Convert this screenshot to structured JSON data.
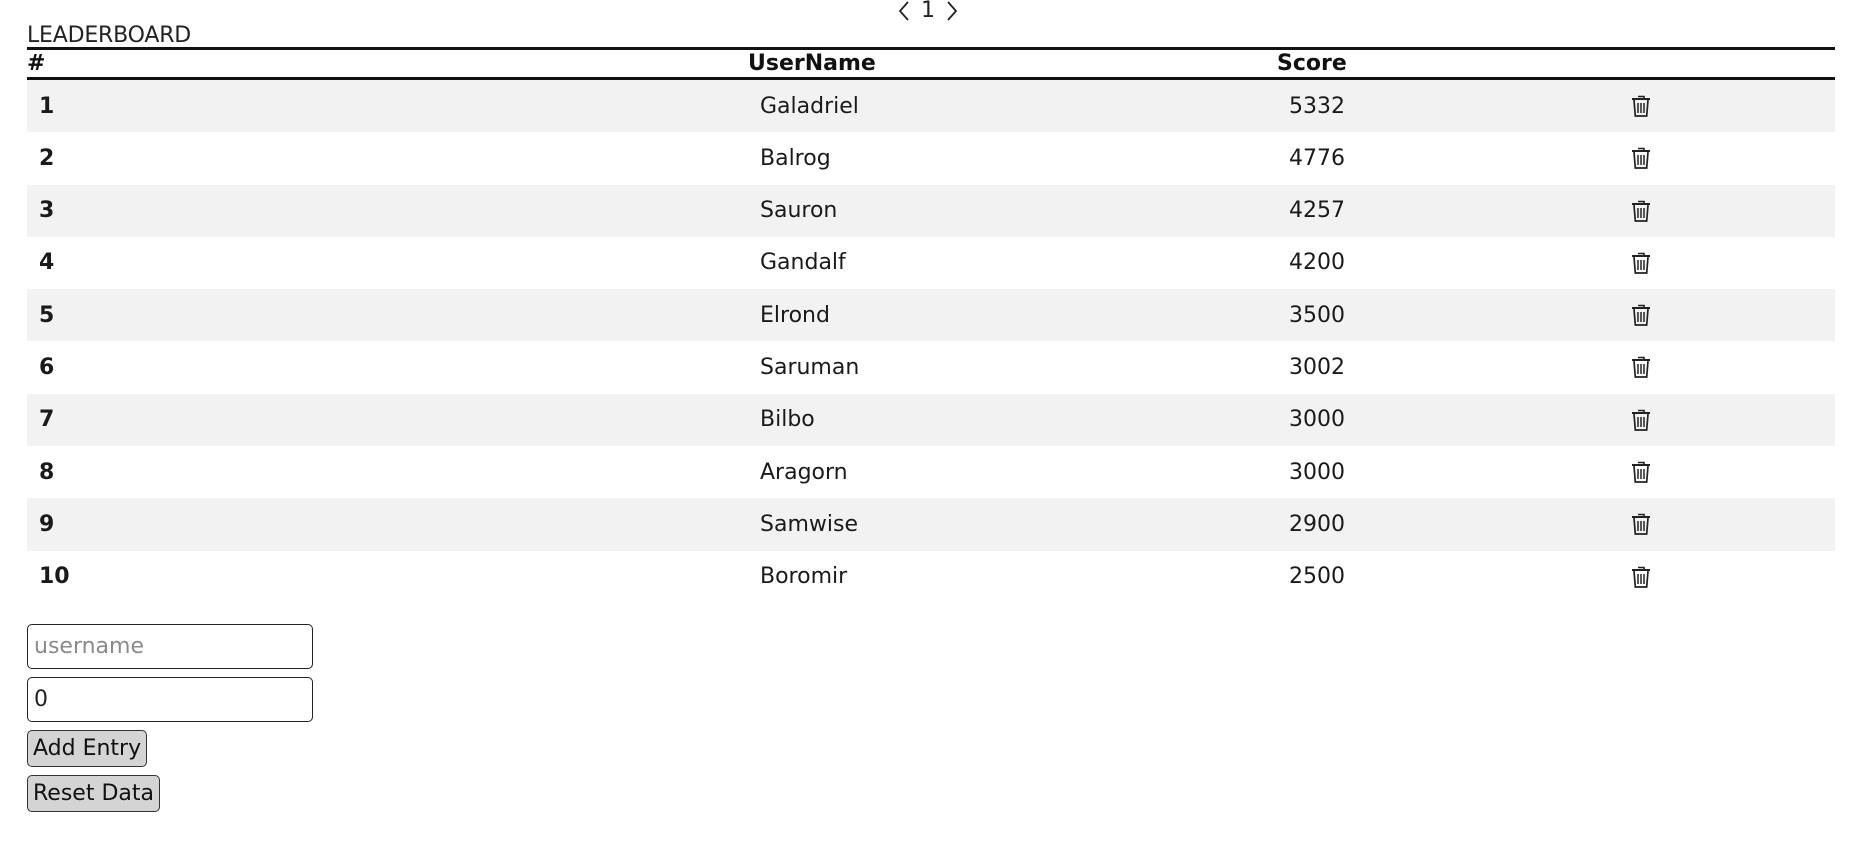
{
  "pager": {
    "prev_icon": "chevron-left-icon",
    "page": "1",
    "next_icon": "chevron-right-icon"
  },
  "title": "LEADERBOARD",
  "table": {
    "headers": {
      "rank": "#",
      "username": "UserName",
      "score": "Score"
    },
    "delete_icon": "trash-icon",
    "rows": [
      {
        "rank": "1",
        "username": "Galadriel",
        "score": "5332"
      },
      {
        "rank": "2",
        "username": "Balrog",
        "score": "4776"
      },
      {
        "rank": "3",
        "username": "Sauron",
        "score": "4257"
      },
      {
        "rank": "4",
        "username": "Gandalf",
        "score": "4200"
      },
      {
        "rank": "5",
        "username": "Elrond",
        "score": "3500"
      },
      {
        "rank": "6",
        "username": "Saruman",
        "score": "3002"
      },
      {
        "rank": "7",
        "username": "Bilbo",
        "score": "3000"
      },
      {
        "rank": "8",
        "username": "Aragorn",
        "score": "3000"
      },
      {
        "rank": "9",
        "username": "Samwise",
        "score": "2900"
      },
      {
        "rank": "10",
        "username": "Boromir",
        "score": "2500"
      }
    ]
  },
  "form": {
    "username_placeholder": "username",
    "username_value": "",
    "score_value": "0",
    "add_label": "Add Entry",
    "reset_label": "Reset Data"
  },
  "colors": {
    "row_stripe": "#f2f2f2",
    "button_bg": "#d4d4d4",
    "border": "#111111"
  }
}
